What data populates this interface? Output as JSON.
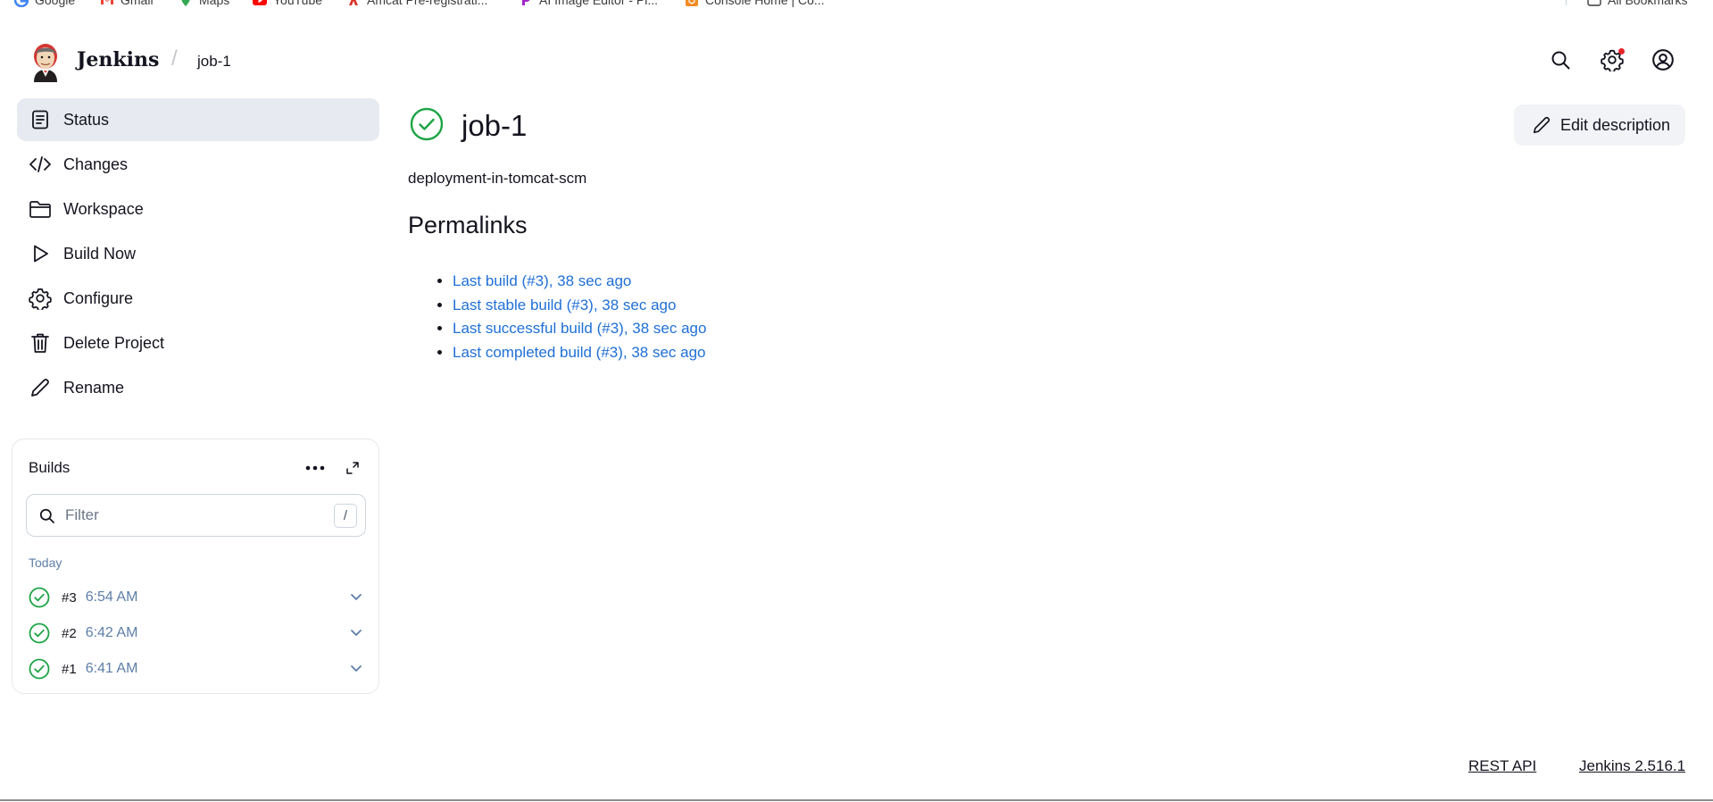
{
  "bookmarks": [
    {
      "label": "Google",
      "icon": "google-icon",
      "color": "#4285f4"
    },
    {
      "label": "Gmail",
      "icon": "gmail-icon",
      "color": "#ea4335"
    },
    {
      "label": "Maps",
      "icon": "maps-icon",
      "color": "#34a853"
    },
    {
      "label": "YouTube",
      "icon": "youtube-icon",
      "color": "#ff0000"
    },
    {
      "label": "Amcat Pre-registrati...",
      "icon": "amcat-icon",
      "color": "#d9342b"
    },
    {
      "label": "AI Image Editor - Pi...",
      "icon": "picsart-icon",
      "color": "#a326c9"
    },
    {
      "label": "Console Home | Co...",
      "icon": "console-icon",
      "color": "#f08c24"
    },
    {
      "label": "All Bookmarks",
      "icon": "folder-icon",
      "color": "#3c3c3c"
    }
  ],
  "header": {
    "brand": "Jenkins",
    "breadcrumb_separator": "/",
    "breadcrumb": "job-1",
    "icons": [
      "search-icon",
      "settings-icon",
      "account-icon"
    ],
    "notification_color": "#e5242a"
  },
  "sidebar": {
    "items": [
      {
        "label": "Status",
        "icon": "status-icon",
        "active": true
      },
      {
        "label": "Changes",
        "icon": "code-icon"
      },
      {
        "label": "Workspace",
        "icon": "folder-icon"
      },
      {
        "label": "Build Now",
        "icon": "play-icon"
      },
      {
        "label": "Configure",
        "icon": "gear-icon"
      },
      {
        "label": "Delete Project",
        "icon": "trash-icon"
      },
      {
        "label": "Rename",
        "icon": "pencil-icon"
      }
    ]
  },
  "builds": {
    "title": "Builds",
    "filter_placeholder": "Filter",
    "shortcut": "/",
    "group_label": "Today",
    "items": [
      {
        "number": "#3",
        "time": "6:54 AM",
        "status": "success"
      },
      {
        "number": "#2",
        "time": "6:42 AM",
        "status": "success"
      },
      {
        "number": "#1",
        "time": "6:41 AM",
        "status": "success"
      }
    ]
  },
  "main": {
    "title": "job-1",
    "description": "deployment-in-tomcat-scm",
    "edit_description_label": "Edit description",
    "permalinks_heading": "Permalinks",
    "permalinks": [
      "Last build (#3), 38 sec ago",
      "Last stable build (#3), 38 sec ago",
      "Last successful build (#3), 38 sec ago",
      "Last completed build (#3), 38 sec ago"
    ]
  },
  "footer": {
    "rest_api": "REST API",
    "version": "Jenkins 2.516.1"
  },
  "colors": {
    "success": "#1ea446",
    "link": "#1f6fd6",
    "active_bg": "#e7ebf1",
    "muted_text": "#5d7ea8"
  }
}
